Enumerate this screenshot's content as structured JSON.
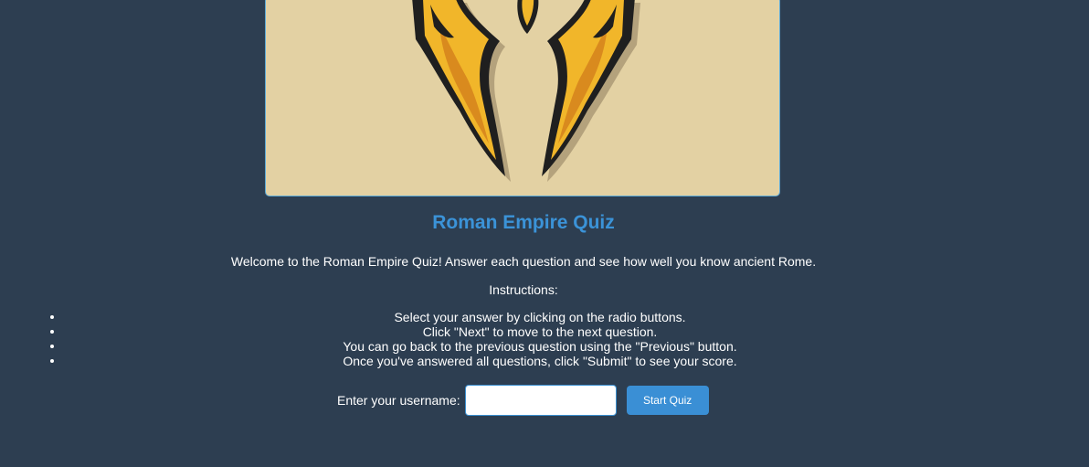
{
  "hero": {
    "image_name": "roman-helmet-logo"
  },
  "quiz": {
    "title": "Roman Empire Quiz",
    "welcome": "Welcome to the Roman Empire Quiz! Answer each question and see how well you know ancient Rome.",
    "instructions_label": "Instructions:",
    "instructions": [
      "Select your answer by clicking on the radio buttons.",
      "Click \"Next\" to move to the next question.",
      "You can go back to the previous question using the \"Previous\" button.",
      "Once you've answered all questions, click \"Submit\" to see your score."
    ]
  },
  "login": {
    "username_label": "Enter your username:",
    "username_value": "",
    "username_placeholder": "",
    "start_label": "Start Quiz"
  },
  "colors": {
    "background": "#2d3e51",
    "accent": "#3a8fd5",
    "hero_bg": "#e3d1a3"
  }
}
